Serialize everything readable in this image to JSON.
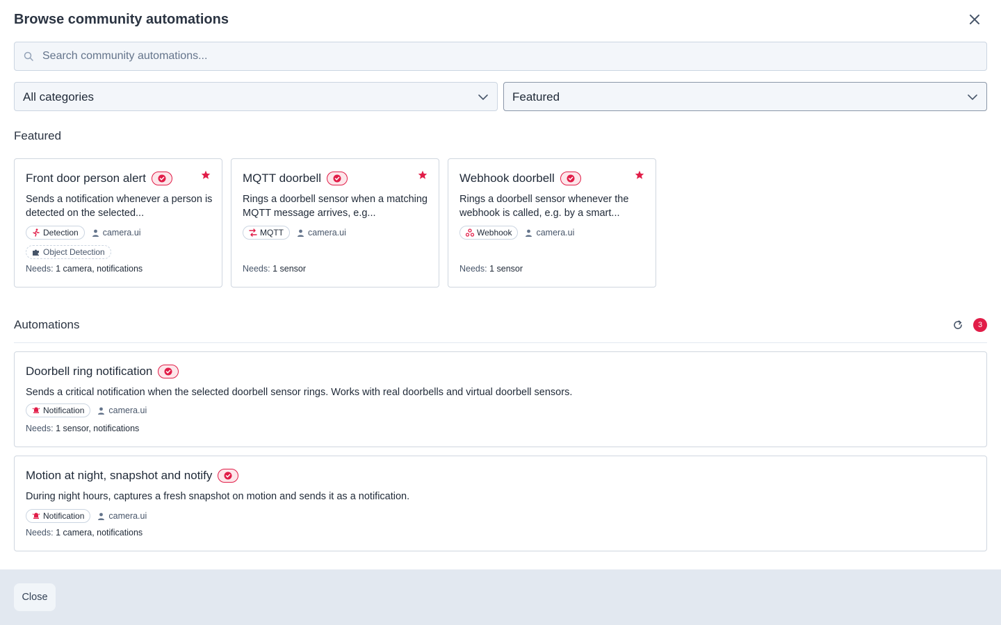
{
  "dialog": {
    "title": "Browse community automations"
  },
  "search": {
    "placeholder": "Search community automations..."
  },
  "filters": {
    "category": "All categories",
    "sort": "Featured"
  },
  "featured": {
    "label": "Featured",
    "cards": [
      {
        "title": "Front door person alert",
        "description": "Sends a notification whenever a person is detected on the selected...",
        "tags": [
          "Detection",
          "Object Detection"
        ],
        "author": "camera.ui",
        "needs_label": "Needs:",
        "needs": "1 camera, notifications"
      },
      {
        "title": "MQTT doorbell",
        "description": "Rings a doorbell sensor when a matching MQTT message arrives, e.g...",
        "tags": [
          "MQTT"
        ],
        "author": "camera.ui",
        "needs_label": "Needs:",
        "needs": "1 sensor"
      },
      {
        "title": "Webhook doorbell",
        "description": "Rings a doorbell sensor whenever the webhook is called, e.g. by a smart...",
        "tags": [
          "Webhook"
        ],
        "author": "camera.ui",
        "needs_label": "Needs:",
        "needs": "1 sensor"
      }
    ]
  },
  "automations": {
    "label": "Automations",
    "count": "3",
    "items": [
      {
        "title": "Doorbell ring notification",
        "description": "Sends a critical notification when the selected doorbell sensor rings. Works with real doorbells and virtual doorbell sensors.",
        "tag": "Notification",
        "author": "camera.ui",
        "needs_label": "Needs:",
        "needs": "1 sensor, notifications"
      },
      {
        "title": "Motion at night, snapshot and notify",
        "description": "During night hours, captures a fresh snapshot on motion and sends it as a notification.",
        "tag": "Notification",
        "author": "camera.ui",
        "needs_label": "Needs:",
        "needs": "1 camera, notifications"
      }
    ]
  },
  "footer": {
    "close_label": "Close"
  },
  "colors": {
    "accent": "#e11d48",
    "footer_bg": "#e2e8f0"
  }
}
